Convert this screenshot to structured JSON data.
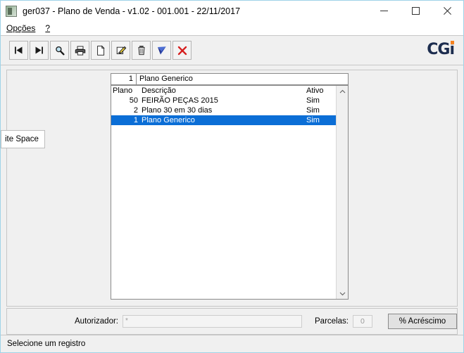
{
  "window": {
    "title": "ger037 - Plano de Venda - v1.02 - 001.001 - 22/11/2017",
    "app_icon": "app-icon",
    "controls": {
      "minimize": "minimize-icon",
      "maximize": "maximize-icon",
      "close": "close-icon"
    }
  },
  "menu": {
    "items": [
      {
        "label": "Opções",
        "accel": "O"
      },
      {
        "label": "?",
        "accel": "?"
      }
    ]
  },
  "toolbar": {
    "buttons": [
      {
        "name": "first-record-icon",
        "tooltip": "Primeiro"
      },
      {
        "name": "last-record-icon",
        "tooltip": "Último"
      },
      {
        "name": "search-icon",
        "tooltip": "Pesquisar"
      },
      {
        "name": "print-icon",
        "tooltip": "Imprimir"
      },
      {
        "name": "new-document-icon",
        "tooltip": "Novo"
      },
      {
        "name": "edit-pencil-icon",
        "tooltip": "Alterar"
      },
      {
        "name": "trash-icon",
        "tooltip": "Excluir"
      },
      {
        "name": "confirm-check-icon",
        "tooltip": "Confirmar"
      },
      {
        "name": "cancel-x-icon",
        "tooltip": "Cancelar"
      }
    ],
    "brand": "CGi",
    "brand_color": "#1d2d4f",
    "brand_accent": "#f58220"
  },
  "record_field": {
    "code": "1",
    "description": "Plano Generico"
  },
  "grid": {
    "columns": [
      "Plano",
      "Descrição",
      "Ativo"
    ],
    "rows": [
      {
        "plano": "50",
        "descricao": "FEIRÃO PEÇAS 2015",
        "ativo": "Sim",
        "selected": false
      },
      {
        "plano": "2",
        "descricao": "Plano 30 em 30 dias",
        "ativo": "Sim",
        "selected": false
      },
      {
        "plano": "1",
        "descricao": "Plano Generico",
        "ativo": "Sim",
        "selected": true
      }
    ],
    "selection_color": "#0b6ed6",
    "scrollbar": {
      "up_arrow": "chevron-up-icon",
      "down_arrow": "chevron-down-icon"
    }
  },
  "tooltip": {
    "text": "ite Space"
  },
  "bottom_form": {
    "autorizador_label": "Autorizador:",
    "autorizador_value": "*",
    "parcelas_label": "Parcelas:",
    "parcelas_value": "0",
    "acrescimo_label": "% Acréscimo"
  },
  "status_bar": {
    "message": "Selecione um registro"
  }
}
